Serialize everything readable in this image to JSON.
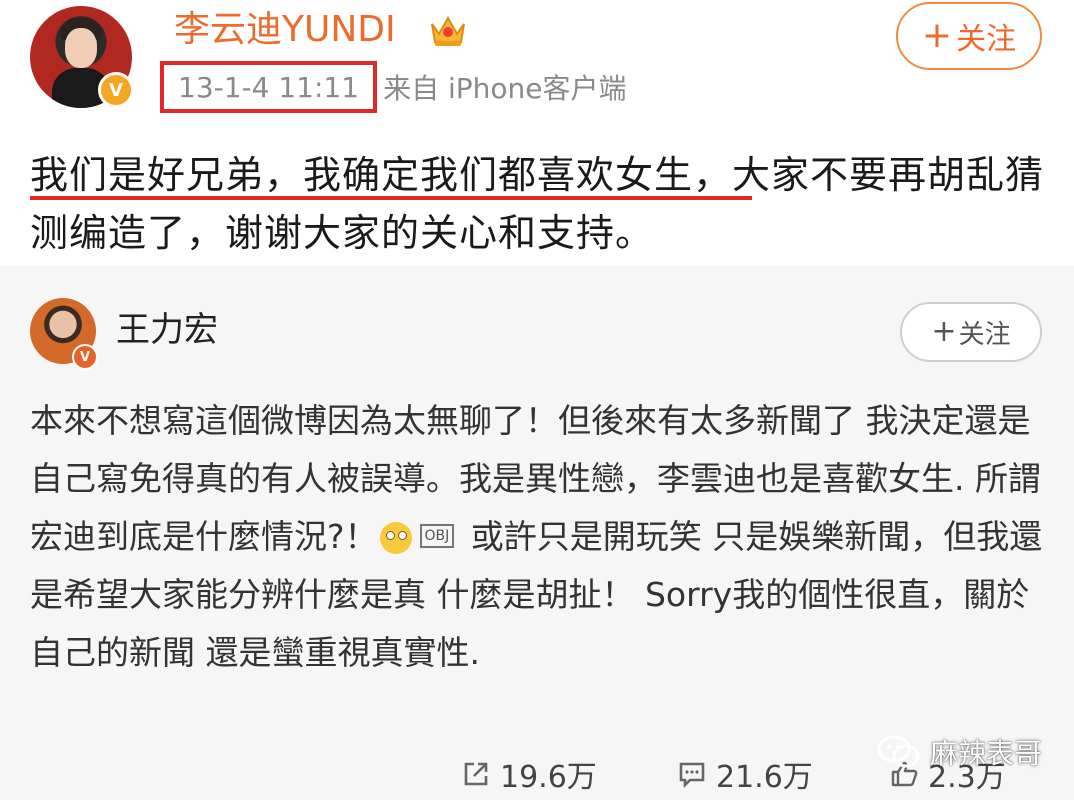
{
  "post": {
    "author": "李云迪YUNDI",
    "timestamp": "13-1-4 11:11",
    "source": "来自 iPhone客户端",
    "follow_label": "关注",
    "follow_plus": "+",
    "verified_mark": "V",
    "crown_icon": "crown-icon",
    "content": "我们是好兄弟，我确定我们都喜欢女生，大家不要再胡乱猜测编造了，谢谢大家的关心和支持。"
  },
  "repost": {
    "author": "王力宏",
    "follow_label": "关注",
    "follow_plus": "+",
    "verified_mark": "V",
    "content_part1": "本來不想寫這個微博因為太無聊了！但後來有太多新聞了 我決定還是自己寫免得真的有人被誤導。我是異性戀，李雲迪也是喜歡女生. 所謂宏迪到底是什麼情況?！",
    "obj_label": "OBJ",
    "content_part2": " 或許只是開玩笑 只是娛樂新聞，但我還是希望大家能分辨什麼是真 什麼是胡扯！ Sorry我的個性很直，關於自己的新聞 還是蠻重視真實性."
  },
  "actions": {
    "share": "19.6万",
    "comment": "21.6万",
    "like": "2.3万"
  },
  "watermark": {
    "text": "麻辣表哥"
  },
  "colors": {
    "accent_orange": "#ee6a2c",
    "highlight_red": "#e02a2a",
    "verified_gold": "#f5a623"
  }
}
